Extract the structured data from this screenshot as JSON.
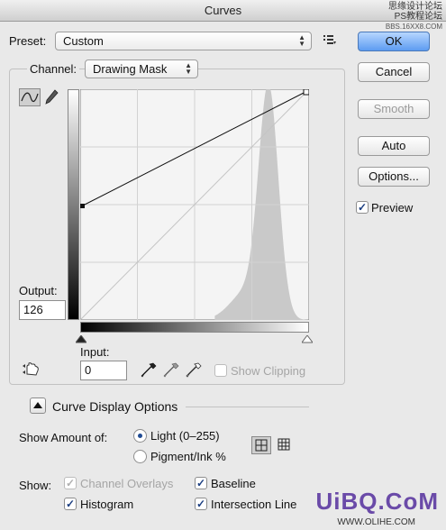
{
  "window": {
    "title": "Curves"
  },
  "watermark_top": {
    "line1": "思缘设计论坛",
    "line2": "PS教程论坛",
    "line3": "BBS.16XX8.COM"
  },
  "preset": {
    "label": "Preset:",
    "value": "Custom"
  },
  "channel": {
    "label": "Channel:",
    "value": "Drawing Mask"
  },
  "buttons": {
    "ok": "OK",
    "cancel": "Cancel",
    "smooth": "Smooth",
    "auto": "Auto",
    "options": "Options..."
  },
  "preview": {
    "label": "Preview",
    "checked": true
  },
  "output": {
    "label": "Output:",
    "value": "126"
  },
  "input": {
    "label": "Input:",
    "value": "0"
  },
  "show_clipping": {
    "label": "Show Clipping",
    "checked": false
  },
  "curve_display_options": {
    "label": "Curve Display Options"
  },
  "show_amount": {
    "label": "Show Amount of:",
    "light": "Light  (0–255)",
    "pigment": "Pigment/Ink %",
    "selected": "light"
  },
  "show": {
    "label": "Show:",
    "channel_overlays": "Channel Overlays",
    "baseline": "Baseline",
    "histogram": "Histogram",
    "intersection_line": "Intersection Line"
  },
  "curve": {
    "start": [
      0,
      126
    ],
    "end": [
      255,
      255
    ]
  },
  "colors": {
    "accent": "#5d9cf1",
    "histogram": "#c9c9c9"
  },
  "watermark_bottom": {
    "text": "UiBQ.CoM",
    "small": "WWW.OLIHE.COM"
  }
}
